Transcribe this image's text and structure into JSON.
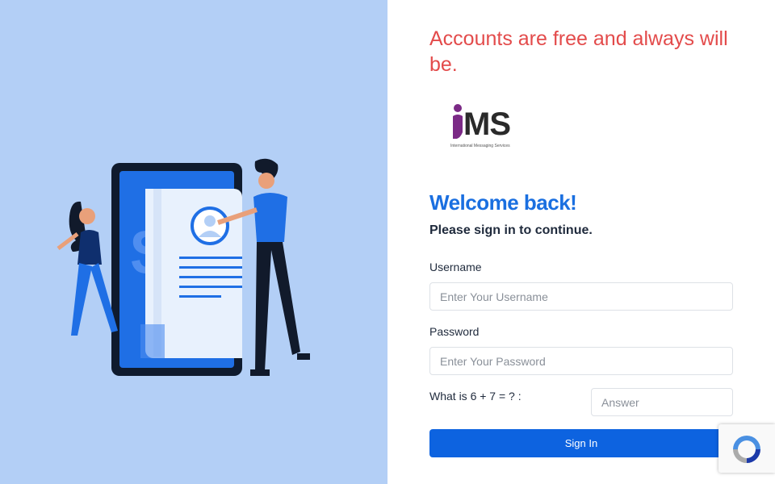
{
  "branding": {
    "tagline": "Accounts are free and always will be.",
    "logo_text": "MS",
    "logo_subtext": "International Messaging Services",
    "colors": {
      "tagline": "#e34b4b",
      "accent": "#1a6fe0",
      "button": "#0d63e0",
      "left_panel": "#b3cff6",
      "logo_i": "#7b2a86"
    }
  },
  "login": {
    "title": "Welcome back!",
    "subtitle": "Please sign in to continue.",
    "username_label": "Username",
    "username_placeholder": "Enter Your Username",
    "password_label": "Password",
    "password_placeholder": "Enter Your Password",
    "captcha_question": "What is 6 + 7 = ? :",
    "captcha_placeholder": "Answer",
    "submit_label": "Sign In"
  },
  "icons": {
    "recaptcha": "recaptcha-icon",
    "illustration": "document-profile-illustration"
  }
}
